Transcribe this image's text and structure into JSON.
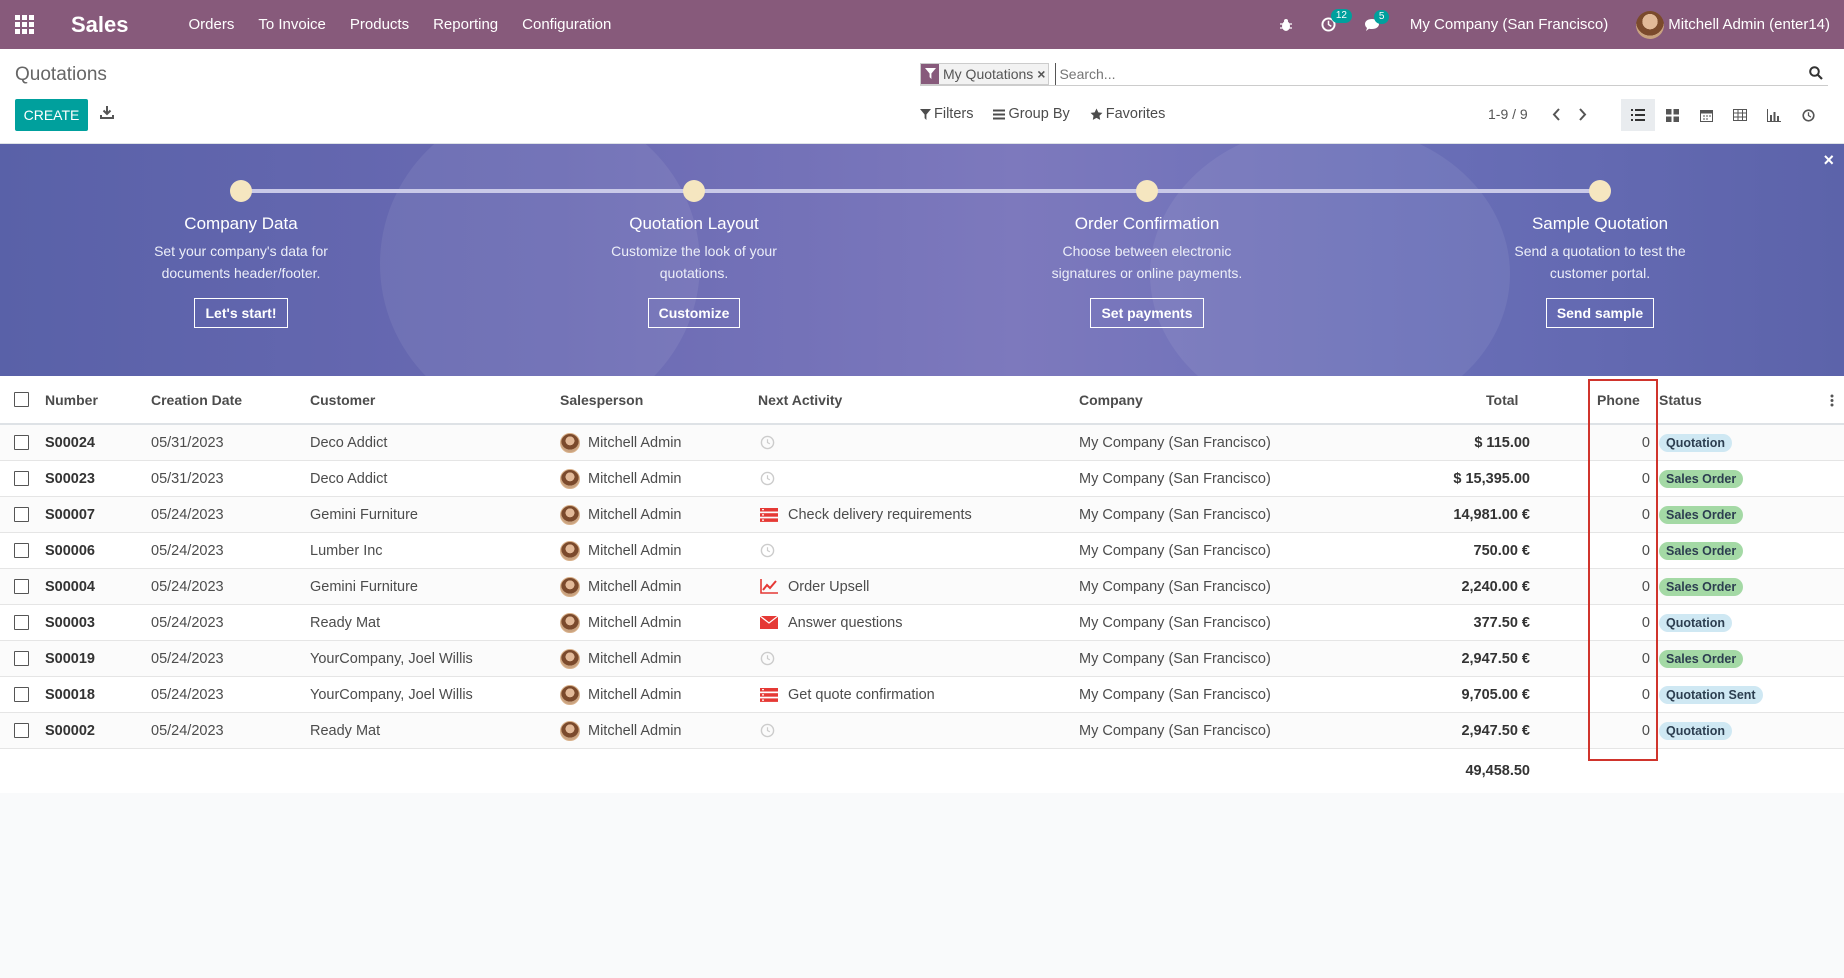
{
  "navbar": {
    "brand": "Sales",
    "menu": [
      "Orders",
      "To Invoice",
      "Products",
      "Reporting",
      "Configuration"
    ],
    "activity_count": "12",
    "message_count": "5",
    "company": "My Company (San Francisco)",
    "user": "Mitchell Admin (enter14)",
    "colors": {
      "navbar": "#875a7b",
      "accent": "#00a09d"
    },
    "icons": [
      "apps-grid-icon",
      "bug-icon",
      "clock-icon",
      "chat-icon"
    ]
  },
  "control_panel": {
    "breadcrumb": "Quotations",
    "create_label": "CREATE",
    "facet_label": "My Quotations",
    "search_placeholder": "Search...",
    "filters_label": "Filters",
    "groupby_label": "Group By",
    "favorites_label": "Favorites",
    "pager": "1-9 / 9",
    "views": [
      "list-view-icon",
      "kanban-view-icon",
      "calendar-view-icon",
      "pivot-view-icon",
      "graph-view-icon",
      "activity-view-icon"
    ]
  },
  "banner": {
    "steps": [
      {
        "title": "Company Data",
        "desc": "Set your company's data for documents header/footer.",
        "button": "Let's start!"
      },
      {
        "title": "Quotation Layout",
        "desc": "Customize the look of your quotations.",
        "button": "Customize"
      },
      {
        "title": "Order Confirmation",
        "desc": "Choose between electronic signatures or online payments.",
        "button": "Set payments"
      },
      {
        "title": "Sample Quotation",
        "desc": "Send a quotation to test the customer portal.",
        "button": "Send sample"
      }
    ]
  },
  "table": {
    "columns": [
      "Number",
      "Creation Date",
      "Customer",
      "Salesperson",
      "Next Activity",
      "Company",
      "Total",
      "Phone",
      "Status"
    ],
    "rows": [
      {
        "number": "S00024",
        "date": "05/31/2023",
        "customer": "Deco Addict",
        "salesperson": "Mitchell Admin",
        "activity": "",
        "activity_icon": "clock-icon",
        "company": "My Company (San Francisco)",
        "total": "$ 115.00",
        "phone": "0",
        "status": "Quotation"
      },
      {
        "number": "S00023",
        "date": "05/31/2023",
        "customer": "Deco Addict",
        "salesperson": "Mitchell Admin",
        "activity": "",
        "activity_icon": "clock-icon",
        "company": "My Company (San Francisco)",
        "total": "$ 15,395.00",
        "phone": "0",
        "status": "Sales Order"
      },
      {
        "number": "S00007",
        "date": "05/24/2023",
        "customer": "Gemini Furniture",
        "salesperson": "Mitchell Admin",
        "activity": "Check delivery requirements",
        "activity_icon": "tasks-icon",
        "company": "My Company (San Francisco)",
        "total": "14,981.00 €",
        "phone": "0",
        "status": "Sales Order"
      },
      {
        "number": "S00006",
        "date": "05/24/2023",
        "customer": "Lumber Inc",
        "salesperson": "Mitchell Admin",
        "activity": "",
        "activity_icon": "clock-icon",
        "company": "My Company (San Francisco)",
        "total": "750.00 €",
        "phone": "0",
        "status": "Sales Order"
      },
      {
        "number": "S00004",
        "date": "05/24/2023",
        "customer": "Gemini Furniture",
        "salesperson": "Mitchell Admin",
        "activity": "Order Upsell",
        "activity_icon": "line-chart-icon",
        "company": "My Company (San Francisco)",
        "total": "2,240.00 €",
        "phone": "0",
        "status": "Sales Order"
      },
      {
        "number": "S00003",
        "date": "05/24/2023",
        "customer": "Ready Mat",
        "salesperson": "Mitchell Admin",
        "activity": "Answer questions",
        "activity_icon": "envelope-icon",
        "company": "My Company (San Francisco)",
        "total": "377.50 €",
        "phone": "0",
        "status": "Quotation"
      },
      {
        "number": "S00019",
        "date": "05/24/2023",
        "customer": "YourCompany, Joel Willis",
        "salesperson": "Mitchell Admin",
        "activity": "",
        "activity_icon": "clock-icon",
        "company": "My Company (San Francisco)",
        "total": "2,947.50 €",
        "phone": "0",
        "status": "Sales Order"
      },
      {
        "number": "S00018",
        "date": "05/24/2023",
        "customer": "YourCompany, Joel Willis",
        "salesperson": "Mitchell Admin",
        "activity": "Get quote confirmation",
        "activity_icon": "tasks-icon",
        "company": "My Company (San Francisco)",
        "total": "9,705.00 €",
        "phone": "0",
        "status": "Quotation Sent"
      },
      {
        "number": "S00002",
        "date": "05/24/2023",
        "customer": "Ready Mat",
        "salesperson": "Mitchell Admin",
        "activity": "",
        "activity_icon": "clock-icon",
        "company": "My Company (San Francisco)",
        "total": "2,947.50 €",
        "phone": "0",
        "status": "Quotation"
      }
    ],
    "grand_total": "49,458.50"
  }
}
